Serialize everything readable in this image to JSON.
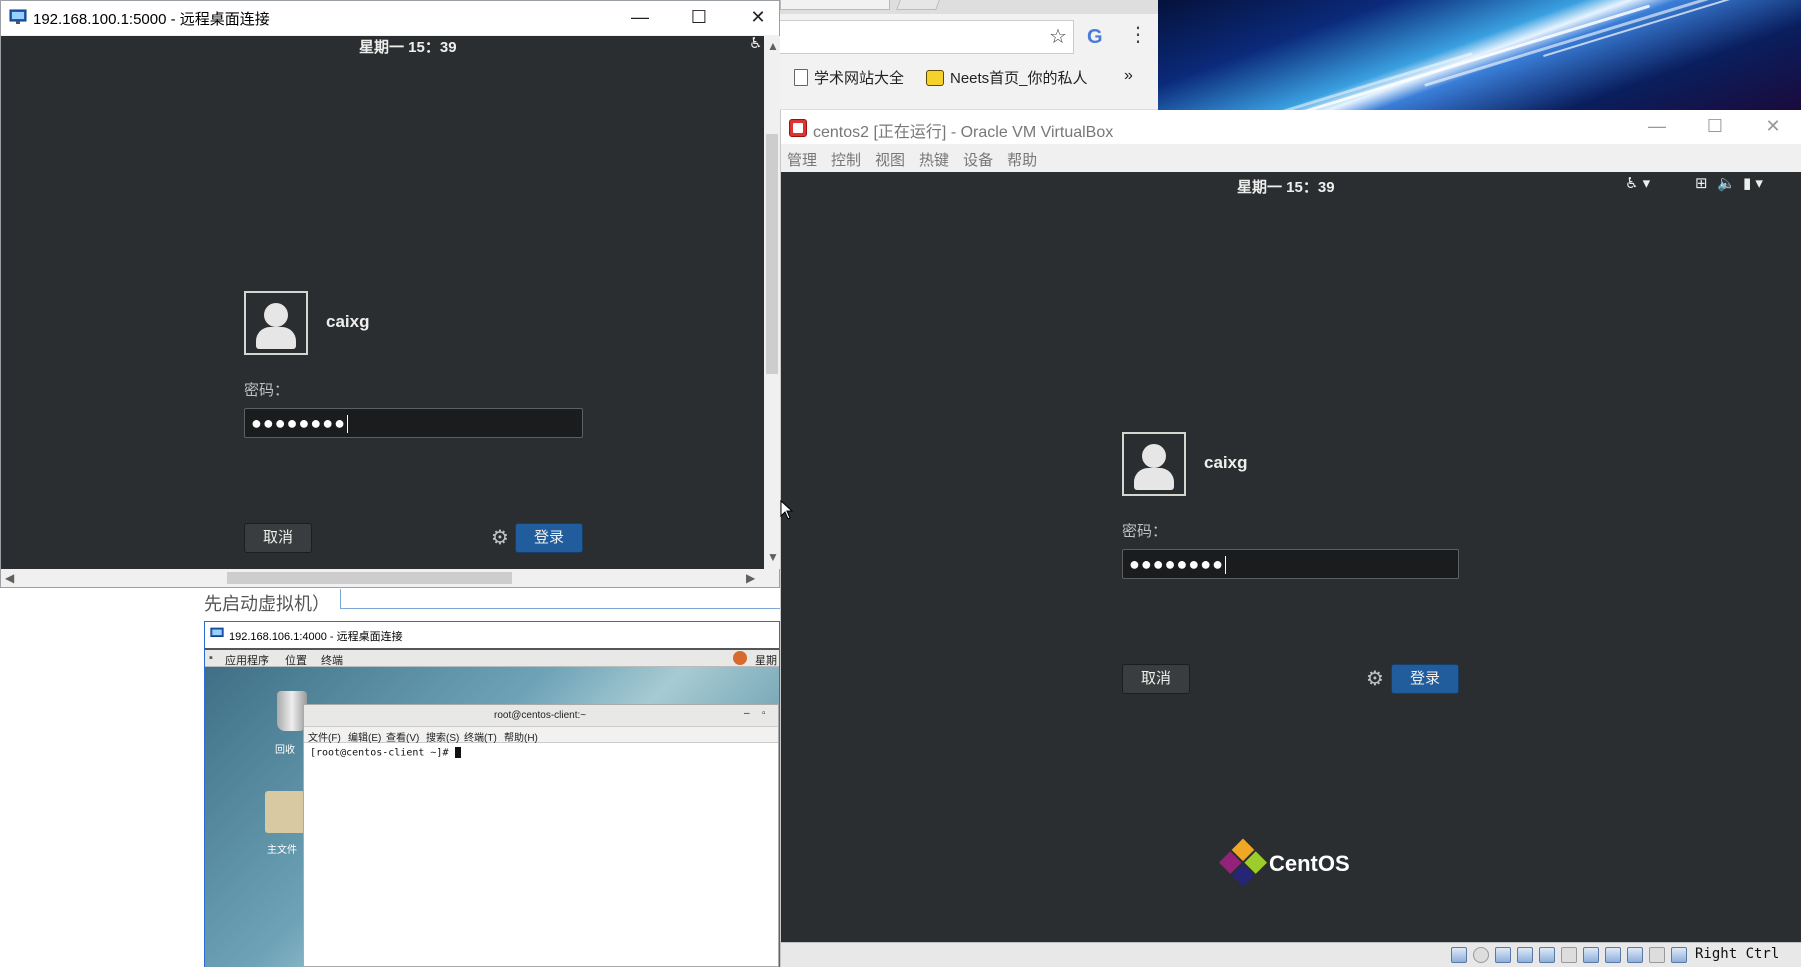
{
  "rdp_window_1": {
    "title": "192.168.100.1:5000 - 远程桌面连接",
    "clock": "星期一 15：39",
    "user": "caixg",
    "password_label": "密码：",
    "password_value": "●●●●●●●●",
    "cancel": "取消",
    "login": "登录"
  },
  "browser": {
    "bookmarks": [
      "学术网站大全",
      "Neets首页_你的私人"
    ],
    "more": "»"
  },
  "vbox": {
    "title": "centos2 [正在运行] - Oracle VM VirtualBox",
    "menu": [
      "管理",
      "控制",
      "视图",
      "热键",
      "设备",
      "帮助"
    ],
    "clock": "星期一 15：39",
    "user": "caixg",
    "password_label": "密码：",
    "password_value": "●●●●●●●●",
    "cancel": "取消",
    "login": "登录",
    "logo_text": "CentOS",
    "host_key": "Right Ctrl"
  },
  "background_doc": {
    "text": "先启动虚拟机）"
  },
  "rdp_window_2": {
    "title": "192.168.106.1:4000 - 远程桌面连接",
    "gnome_menu": [
      "应用程序",
      "位置",
      "终端"
    ],
    "gnome_right": "星期",
    "terminal_title": "root@centos-client:~",
    "terminal_menu": [
      "文件(F)",
      "编辑(E)",
      "查看(V)",
      "搜索(S)",
      "终端(T)",
      "帮助(H)"
    ],
    "prompt": "[root@centos-client ~]# ",
    "desktop_labels": [
      "回收",
      "主文件"
    ]
  },
  "colors": {
    "gdm_bg": "#2b2e31",
    "login_button": "#215d9c"
  }
}
